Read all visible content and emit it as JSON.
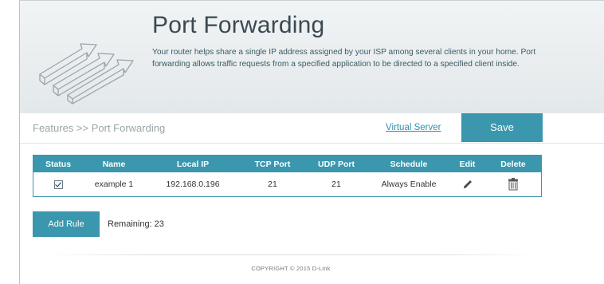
{
  "header": {
    "title": "Port Forwarding",
    "description": "Your router helps share a single IP address assigned by your ISP among several clients in your home. Port forwarding allows traffic requests from a specified application to be directed to a specified client inside."
  },
  "subbar": {
    "breadcrumb": "Features >> Port Forwarding",
    "virtual_server_link": "Virtual Server",
    "save_label": "Save"
  },
  "table": {
    "columns": [
      "Status",
      "Name",
      "Local IP",
      "TCP Port",
      "UDP Port",
      "Schedule",
      "Edit",
      "Delete"
    ],
    "rows": [
      {
        "status_checked": true,
        "name": "example 1",
        "local_ip": "192.168.0.196",
        "tcp_port": "21",
        "udp_port": "21",
        "schedule": "Always Enable",
        "edit_icon": "pencil-icon",
        "delete_icon": "trash-icon"
      }
    ]
  },
  "actions": {
    "add_rule_label": "Add Rule",
    "remaining_label": "Remaining:",
    "remaining_value": "23"
  },
  "footer": {
    "copyright": "COPYRIGHT © 2015 D-Link"
  },
  "colors": {
    "accent": "#3a97ae",
    "link": "#2f8fb0",
    "header_bg": "#e8ecee"
  }
}
